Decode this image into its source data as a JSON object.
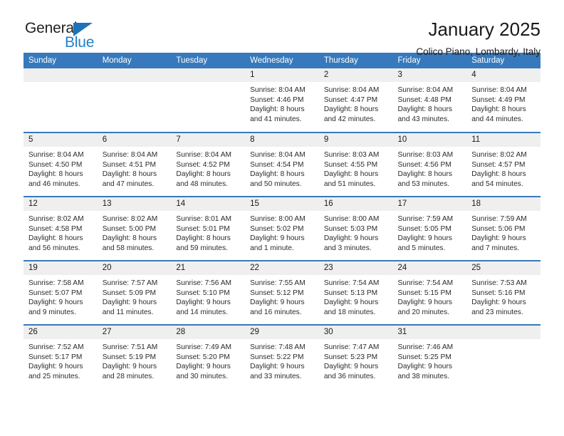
{
  "brand": {
    "name_top": "General",
    "name_bottom": "Blue",
    "triangle_color": "#1e72bb",
    "text_color_top": "#231f20",
    "text_color_bottom": "#2081c8"
  },
  "header": {
    "title": "January 2025",
    "subtitle": "Colico Piano, Lombardy, Italy"
  },
  "theme": {
    "header_row_bg": "#3779bc",
    "header_row_text": "#ffffff",
    "daynum_band_bg": "#efefef",
    "cell_bg": "#ffffff",
    "row_divider": "#3779bc"
  },
  "weekday_headers": [
    "Sunday",
    "Monday",
    "Tuesday",
    "Wednesday",
    "Thursday",
    "Friday",
    "Saturday"
  ],
  "weeks": [
    [
      {
        "day": "",
        "lines": []
      },
      {
        "day": "",
        "lines": []
      },
      {
        "day": "",
        "lines": []
      },
      {
        "day": "1",
        "lines": [
          "Sunrise: 8:04 AM",
          "Sunset: 4:46 PM",
          "Daylight: 8 hours",
          "and 41 minutes."
        ]
      },
      {
        "day": "2",
        "lines": [
          "Sunrise: 8:04 AM",
          "Sunset: 4:47 PM",
          "Daylight: 8 hours",
          "and 42 minutes."
        ]
      },
      {
        "day": "3",
        "lines": [
          "Sunrise: 8:04 AM",
          "Sunset: 4:48 PM",
          "Daylight: 8 hours",
          "and 43 minutes."
        ]
      },
      {
        "day": "4",
        "lines": [
          "Sunrise: 8:04 AM",
          "Sunset: 4:49 PM",
          "Daylight: 8 hours",
          "and 44 minutes."
        ]
      }
    ],
    [
      {
        "day": "5",
        "lines": [
          "Sunrise: 8:04 AM",
          "Sunset: 4:50 PM",
          "Daylight: 8 hours",
          "and 46 minutes."
        ]
      },
      {
        "day": "6",
        "lines": [
          "Sunrise: 8:04 AM",
          "Sunset: 4:51 PM",
          "Daylight: 8 hours",
          "and 47 minutes."
        ]
      },
      {
        "day": "7",
        "lines": [
          "Sunrise: 8:04 AM",
          "Sunset: 4:52 PM",
          "Daylight: 8 hours",
          "and 48 minutes."
        ]
      },
      {
        "day": "8",
        "lines": [
          "Sunrise: 8:04 AM",
          "Sunset: 4:54 PM",
          "Daylight: 8 hours",
          "and 50 minutes."
        ]
      },
      {
        "day": "9",
        "lines": [
          "Sunrise: 8:03 AM",
          "Sunset: 4:55 PM",
          "Daylight: 8 hours",
          "and 51 minutes."
        ]
      },
      {
        "day": "10",
        "lines": [
          "Sunrise: 8:03 AM",
          "Sunset: 4:56 PM",
          "Daylight: 8 hours",
          "and 53 minutes."
        ]
      },
      {
        "day": "11",
        "lines": [
          "Sunrise: 8:02 AM",
          "Sunset: 4:57 PM",
          "Daylight: 8 hours",
          "and 54 minutes."
        ]
      }
    ],
    [
      {
        "day": "12",
        "lines": [
          "Sunrise: 8:02 AM",
          "Sunset: 4:58 PM",
          "Daylight: 8 hours",
          "and 56 minutes."
        ]
      },
      {
        "day": "13",
        "lines": [
          "Sunrise: 8:02 AM",
          "Sunset: 5:00 PM",
          "Daylight: 8 hours",
          "and 58 minutes."
        ]
      },
      {
        "day": "14",
        "lines": [
          "Sunrise: 8:01 AM",
          "Sunset: 5:01 PM",
          "Daylight: 8 hours",
          "and 59 minutes."
        ]
      },
      {
        "day": "15",
        "lines": [
          "Sunrise: 8:00 AM",
          "Sunset: 5:02 PM",
          "Daylight: 9 hours",
          "and 1 minute."
        ]
      },
      {
        "day": "16",
        "lines": [
          "Sunrise: 8:00 AM",
          "Sunset: 5:03 PM",
          "Daylight: 9 hours",
          "and 3 minutes."
        ]
      },
      {
        "day": "17",
        "lines": [
          "Sunrise: 7:59 AM",
          "Sunset: 5:05 PM",
          "Daylight: 9 hours",
          "and 5 minutes."
        ]
      },
      {
        "day": "18",
        "lines": [
          "Sunrise: 7:59 AM",
          "Sunset: 5:06 PM",
          "Daylight: 9 hours",
          "and 7 minutes."
        ]
      }
    ],
    [
      {
        "day": "19",
        "lines": [
          "Sunrise: 7:58 AM",
          "Sunset: 5:07 PM",
          "Daylight: 9 hours",
          "and 9 minutes."
        ]
      },
      {
        "day": "20",
        "lines": [
          "Sunrise: 7:57 AM",
          "Sunset: 5:09 PM",
          "Daylight: 9 hours",
          "and 11 minutes."
        ]
      },
      {
        "day": "21",
        "lines": [
          "Sunrise: 7:56 AM",
          "Sunset: 5:10 PM",
          "Daylight: 9 hours",
          "and 14 minutes."
        ]
      },
      {
        "day": "22",
        "lines": [
          "Sunrise: 7:55 AM",
          "Sunset: 5:12 PM",
          "Daylight: 9 hours",
          "and 16 minutes."
        ]
      },
      {
        "day": "23",
        "lines": [
          "Sunrise: 7:54 AM",
          "Sunset: 5:13 PM",
          "Daylight: 9 hours",
          "and 18 minutes."
        ]
      },
      {
        "day": "24",
        "lines": [
          "Sunrise: 7:54 AM",
          "Sunset: 5:15 PM",
          "Daylight: 9 hours",
          "and 20 minutes."
        ]
      },
      {
        "day": "25",
        "lines": [
          "Sunrise: 7:53 AM",
          "Sunset: 5:16 PM",
          "Daylight: 9 hours",
          "and 23 minutes."
        ]
      }
    ],
    [
      {
        "day": "26",
        "lines": [
          "Sunrise: 7:52 AM",
          "Sunset: 5:17 PM",
          "Daylight: 9 hours",
          "and 25 minutes."
        ]
      },
      {
        "day": "27",
        "lines": [
          "Sunrise: 7:51 AM",
          "Sunset: 5:19 PM",
          "Daylight: 9 hours",
          "and 28 minutes."
        ]
      },
      {
        "day": "28",
        "lines": [
          "Sunrise: 7:49 AM",
          "Sunset: 5:20 PM",
          "Daylight: 9 hours",
          "and 30 minutes."
        ]
      },
      {
        "day": "29",
        "lines": [
          "Sunrise: 7:48 AM",
          "Sunset: 5:22 PM",
          "Daylight: 9 hours",
          "and 33 minutes."
        ]
      },
      {
        "day": "30",
        "lines": [
          "Sunrise: 7:47 AM",
          "Sunset: 5:23 PM",
          "Daylight: 9 hours",
          "and 36 minutes."
        ]
      },
      {
        "day": "31",
        "lines": [
          "Sunrise: 7:46 AM",
          "Sunset: 5:25 PM",
          "Daylight: 9 hours",
          "and 38 minutes."
        ]
      },
      {
        "day": "",
        "lines": []
      }
    ]
  ]
}
